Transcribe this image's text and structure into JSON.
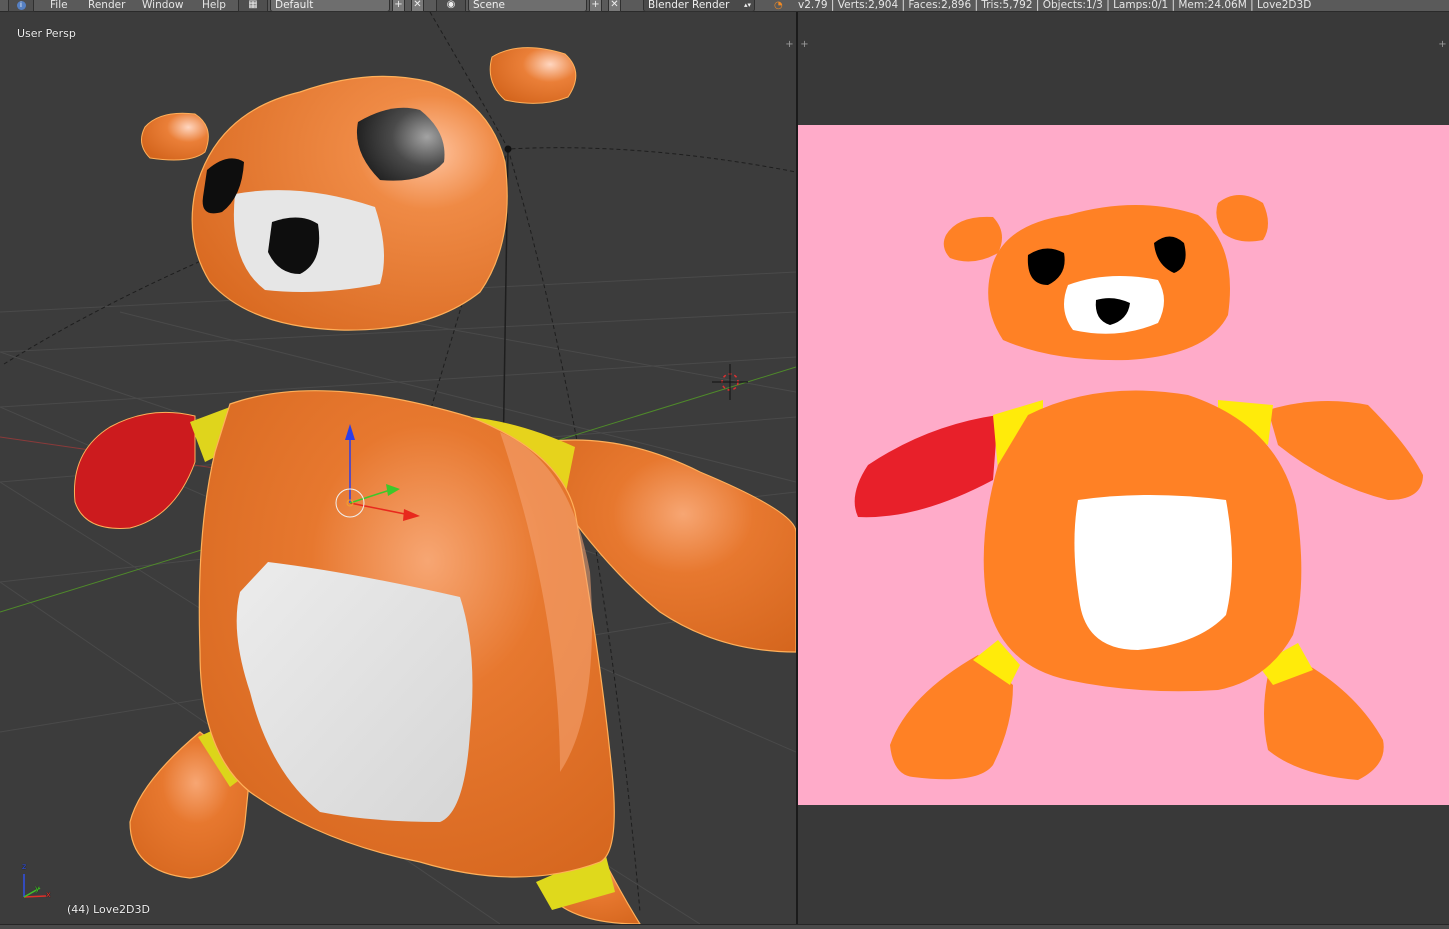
{
  "topbar": {
    "menus": [
      "File",
      "Render",
      "Window",
      "Help"
    ],
    "layout_value": "Default",
    "scene_value": "Scene",
    "engine_value": "Blender Render",
    "stats": "v2.79 | Verts:2,904 | Faces:2,896 | Tris:5,792 | Objects:1/3 | Lamps:0/1 | Mem:24.06M | Love2D3D"
  },
  "viewport": {
    "view_label": "User Persp",
    "object_label": "(44) Love2D3D",
    "axis_labels": {
      "z": "z",
      "y": "y",
      "x": "x"
    }
  },
  "icons": {
    "info": "info-icon",
    "layout": "screen-layout-icon",
    "scene": "scene-icon",
    "blender": "blender-logo-icon",
    "add": "plus-icon",
    "close": "close-icon",
    "cursor": "3d-cursor-icon",
    "gizmo": "transform-gizmo-icon"
  },
  "colors": {
    "bear_orange": "#ff8125",
    "bear_pink_bg": "#ffabc9",
    "mesh_orange": "#e27023",
    "mitten_red": "#e8202a",
    "patch_yellow": "#ffeb0a"
  }
}
